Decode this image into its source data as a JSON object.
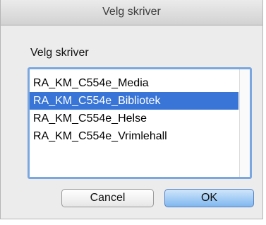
{
  "window": {
    "title": "Velg skriver"
  },
  "dialog": {
    "prompt": "Velg skriver"
  },
  "printer_list": {
    "items": [
      {
        "label": "RA_KM_C554e_Media",
        "selected": false
      },
      {
        "label": "RA_KM_C554e_Bibliotek",
        "selected": true
      },
      {
        "label": "RA_KM_C554e_Helse",
        "selected": false
      },
      {
        "label": "RA_KM_C554e_Vrimlehall",
        "selected": false
      }
    ]
  },
  "buttons": {
    "cancel_label": "Cancel",
    "ok_label": "OK"
  },
  "colors": {
    "selection": "#3875d7",
    "focus_ring": "#7aa7e0",
    "default_button": "#7fb7ef"
  }
}
